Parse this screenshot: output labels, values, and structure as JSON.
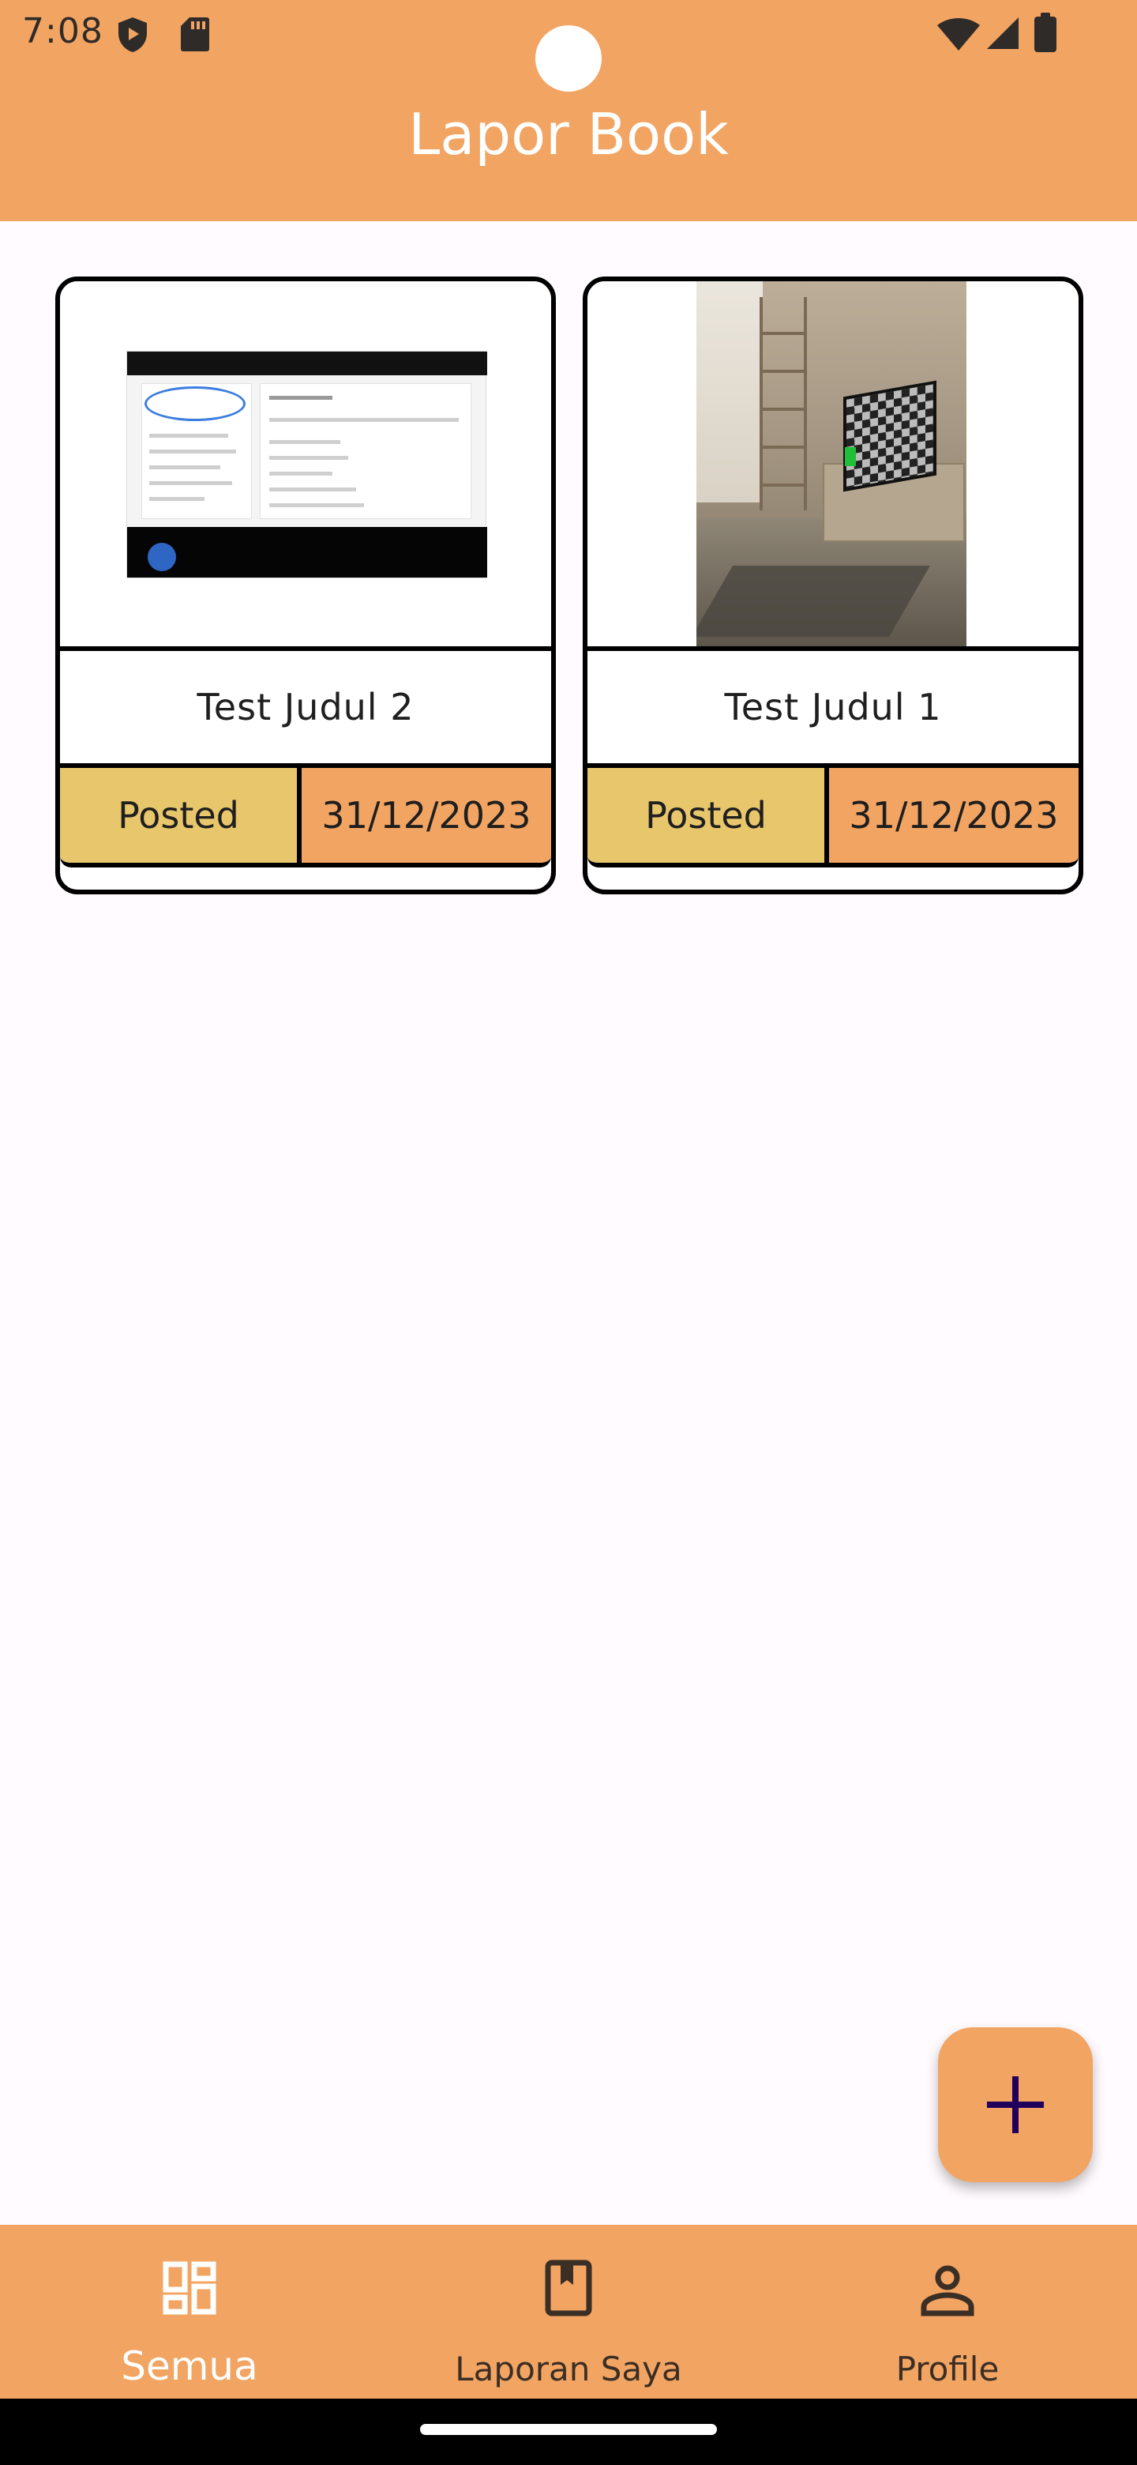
{
  "status_bar": {
    "time": "7:08",
    "icons": [
      "shield-play-icon",
      "sd-card-icon",
      "wifi-icon",
      "signal-icon",
      "battery-icon"
    ]
  },
  "app_bar": {
    "title": "Lapor Book",
    "color": "#f2a462"
  },
  "reports": [
    {
      "title": "Test Judul 2",
      "status": "Posted",
      "date": "31/12/2023",
      "image": "website-screenshot"
    },
    {
      "title": "Test Judul 1",
      "status": "Posted",
      "date": "31/12/2023",
      "image": "room-with-tv-photo"
    }
  ],
  "fab": {
    "icon": "plus-icon",
    "color": "#f2a462"
  },
  "bottom_nav": {
    "items": [
      {
        "label": "Semua",
        "icon": "dashboard-icon",
        "selected": true
      },
      {
        "label": "Laporan Saya",
        "icon": "book-icon",
        "selected": false
      },
      {
        "label": "Profile",
        "icon": "person-icon",
        "selected": false
      }
    ]
  },
  "colors": {
    "accent": "#f2a462",
    "status_posted": "#e8c66b",
    "background": "#fffbfe"
  }
}
